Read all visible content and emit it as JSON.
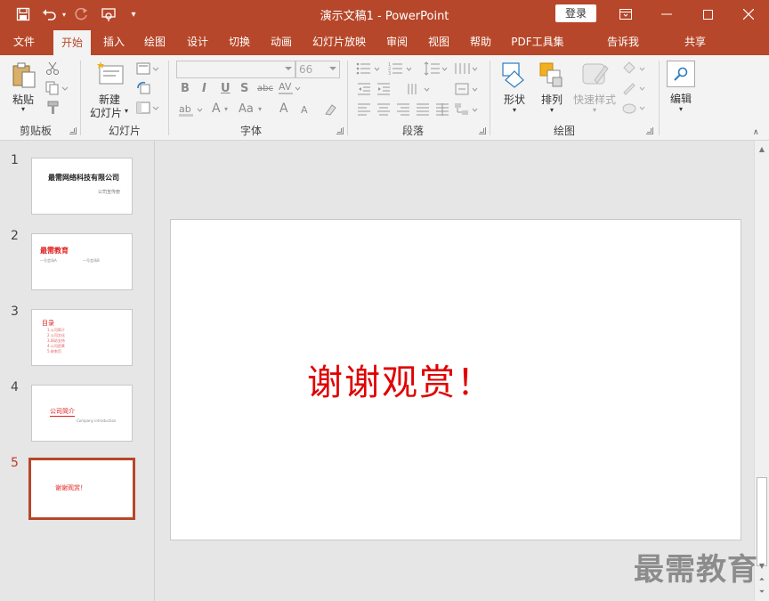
{
  "window": {
    "title": "演示文稿1  -  PowerPoint",
    "login_label": "登录"
  },
  "tabs": [
    {
      "label": "文件",
      "active": false
    },
    {
      "label": "开始",
      "active": true
    },
    {
      "label": "插入",
      "active": false
    },
    {
      "label": "绘图",
      "active": false
    },
    {
      "label": "设计",
      "active": false
    },
    {
      "label": "切换",
      "active": false
    },
    {
      "label": "动画",
      "active": false
    },
    {
      "label": "幻灯片放映",
      "active": false
    },
    {
      "label": "审阅",
      "active": false
    },
    {
      "label": "视图",
      "active": false
    },
    {
      "label": "帮助",
      "active": false
    },
    {
      "label": "PDF工具集",
      "active": false
    },
    {
      "label": "告诉我",
      "active": false
    },
    {
      "label": "共享",
      "active": false
    }
  ],
  "ribbon": {
    "clipboard": {
      "paste_label": "粘贴",
      "group_label": "剪贴板"
    },
    "slides": {
      "new_slide_label_1": "新建",
      "new_slide_label_2": "幻灯片",
      "group_label": "幻灯片"
    },
    "font": {
      "font_name": "",
      "font_size": "66",
      "group_label": "字体",
      "bold": "B",
      "italic": "I",
      "underline": "U",
      "shadow": "S",
      "strike": "abc",
      "font_color": "A",
      "case": "Aa",
      "grow": "A",
      "shrink": "A"
    },
    "paragraph": {
      "group_label": "段落"
    },
    "drawing": {
      "shapes_label": "形状",
      "arrange_label": "排列",
      "quick_styles_label": "快速样式",
      "group_label": "绘图"
    },
    "editing": {
      "label": "编辑"
    }
  },
  "slides": [
    {
      "number": "1",
      "title": "最需网络科技有限公司",
      "subtitle": "公司宣传册",
      "selected": false
    },
    {
      "number": "2",
      "title": "最需教育",
      "left": "一号会场A",
      "right": "一号会场B",
      "selected": false
    },
    {
      "number": "3",
      "title": "目录",
      "items": [
        "1.公司简介",
        "2.公司文化",
        "3.网站支持",
        "4.公司愿景",
        "5.结束页"
      ],
      "selected": false
    },
    {
      "number": "4",
      "title": "公司简介",
      "subtitle": "Company introduction",
      "selected": false
    },
    {
      "number": "5",
      "title": "谢谢观赏！",
      "selected": true
    }
  ],
  "current_slide": {
    "text": "谢谢观赏！",
    "text_color": "#e00000"
  },
  "watermark": "最需教育",
  "colors": {
    "accent": "#b7472a"
  }
}
